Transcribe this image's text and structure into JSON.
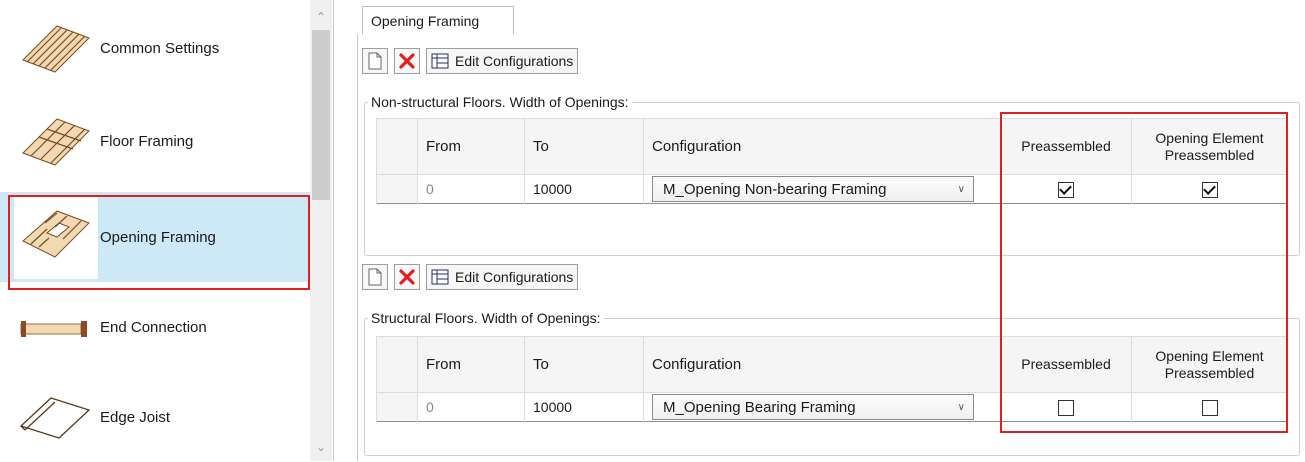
{
  "sidebar": {
    "items": [
      {
        "label": "Common Settings",
        "icon": "common-settings-icon"
      },
      {
        "label": "Floor Framing",
        "icon": "floor-framing-icon"
      },
      {
        "label": "Opening Framing",
        "icon": "opening-framing-icon",
        "selected": true
      },
      {
        "label": "End Connection",
        "icon": "end-connection-icon"
      },
      {
        "label": "Edge Joist",
        "icon": "edge-joist-icon"
      }
    ]
  },
  "tabs": [
    {
      "label": "Opening Framing",
      "active": true
    }
  ],
  "toolbar": {
    "edit_label": "Edit Configurations"
  },
  "sections": [
    {
      "legend": "Non-structural Floors. Width of Openings:",
      "columns": {
        "from": "From",
        "to": "To",
        "configuration": "Configuration",
        "preassembled": "Preassembled",
        "opening_element": "Opening Element Preassembled"
      },
      "rows": [
        {
          "from": "0",
          "to": "10000",
          "configuration": "M_Opening Non-bearing Framing",
          "preassembled": true,
          "opening_element_preassembled": true
        }
      ]
    },
    {
      "legend": "Structural Floors. Width of Openings:",
      "columns": {
        "from": "From",
        "to": "To",
        "configuration": "Configuration",
        "preassembled": "Preassembled",
        "opening_element": "Opening Element Preassembled"
      },
      "rows": [
        {
          "from": "0",
          "to": "10000",
          "configuration": "M_Opening Bearing Framing",
          "preassembled": false,
          "opening_element_preassembled": false
        }
      ]
    }
  ],
  "colors": {
    "selection_bg": "#cde8f7",
    "highlight": "#e02020",
    "delete_red": "#e02020"
  }
}
